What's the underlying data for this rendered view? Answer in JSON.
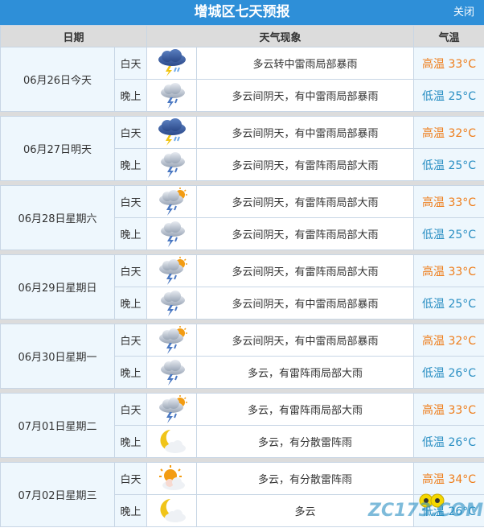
{
  "header": {
    "title": "增城区七天预报",
    "close_label": "关闭"
  },
  "columns": {
    "date": "日期",
    "weather": "天气现象",
    "temp": "气温"
  },
  "days": [
    {
      "date": "06月26日今天",
      "day": {
        "label": "白天",
        "icon": "thunder-rain-icon",
        "desc": "多云转中雷雨局部暴雨",
        "temp": "高温 33°C"
      },
      "night": {
        "label": "晚上",
        "icon": "cloud-thunder-rain-icon",
        "desc": "多云间阴天，有中雷雨局部暴雨",
        "temp": "低温 25°C"
      }
    },
    {
      "date": "06月27日明天",
      "day": {
        "label": "白天",
        "icon": "thunder-rain-icon",
        "desc": "多云间阴天，有中雷雨局部暴雨",
        "temp": "高温 32°C"
      },
      "night": {
        "label": "晚上",
        "icon": "cloud-thunder-rain-icon",
        "desc": "多云间阴天，有雷阵雨局部大雨",
        "temp": "低温 25°C"
      }
    },
    {
      "date": "06月28日星期六",
      "day": {
        "label": "白天",
        "icon": "sun-cloud-thunder-icon",
        "desc": "多云间阴天，有雷阵雨局部大雨",
        "temp": "高温 33°C"
      },
      "night": {
        "label": "晚上",
        "icon": "cloud-thunder-rain-icon",
        "desc": "多云间阴天，有雷阵雨局部大雨",
        "temp": "低温 25°C"
      }
    },
    {
      "date": "06月29日星期日",
      "day": {
        "label": "白天",
        "icon": "sun-cloud-thunder-icon",
        "desc": "多云间阴天，有雷阵雨局部大雨",
        "temp": "高温 33°C"
      },
      "night": {
        "label": "晚上",
        "icon": "cloud-thunder-rain-icon",
        "desc": "多云间阴天，有中雷雨局部暴雨",
        "temp": "低温 25°C"
      }
    },
    {
      "date": "06月30日星期一",
      "day": {
        "label": "白天",
        "icon": "sun-cloud-thunder-icon",
        "desc": "多云间阴天，有中雷雨局部暴雨",
        "temp": "高温 32°C"
      },
      "night": {
        "label": "晚上",
        "icon": "cloud-thunder-rain-icon",
        "desc": "多云，有雷阵雨局部大雨",
        "temp": "低温 26°C"
      }
    },
    {
      "date": "07月01日星期二",
      "day": {
        "label": "白天",
        "icon": "sun-cloud-thunder-icon",
        "desc": "多云，有雷阵雨局部大雨",
        "temp": "高温 33°C"
      },
      "night": {
        "label": "晚上",
        "icon": "moon-cloud-icon",
        "desc": "多云，有分散雷阵雨",
        "temp": "低温 26°C"
      }
    },
    {
      "date": "07月02日星期三",
      "day": {
        "label": "白天",
        "icon": "sun-cloud-icon",
        "desc": "多云，有分散雷阵雨",
        "temp": "高温 34°C"
      },
      "night": {
        "label": "晚上",
        "icon": "moon-cloud-icon",
        "desc": "多云",
        "temp": "低温 26°C"
      }
    }
  ],
  "watermark": {
    "text": "ZC173.COM"
  },
  "colors": {
    "titlebar": "#2e8fd8",
    "high": "#ee7d1a",
    "low": "#2a8fc3",
    "cell_bg": "#eef7fd",
    "header_bg": "#dcdcdc"
  }
}
